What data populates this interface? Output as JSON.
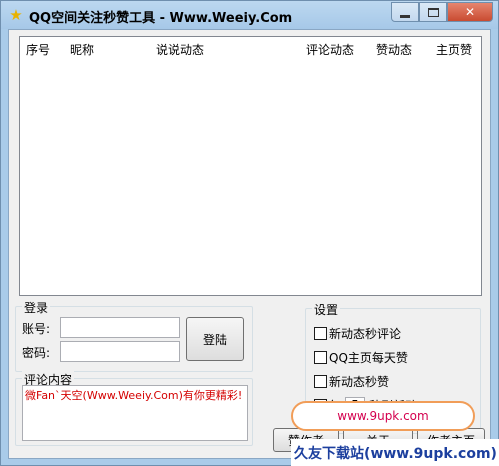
{
  "window": {
    "title": "QQ空间关注秒赞工具 - Www.Weeiy.Com",
    "app_icon": "star-icon",
    "controls": {
      "minimize": "",
      "maximize": "",
      "close": "✕"
    }
  },
  "listview": {
    "columns": [
      "序号",
      "昵称",
      "说说动态",
      "评论动态",
      "赞动态",
      "主页赞"
    ]
  },
  "login": {
    "group_title": "登录",
    "account_label": "账号:",
    "account_value": "",
    "password_label": "密码:",
    "password_value": "",
    "login_button": "登陆"
  },
  "comment": {
    "group_title": "评论内容",
    "text": "微Fan`天空(Www.Weeiy.Com)有你更精彩!"
  },
  "settings": {
    "group_title": "设置",
    "options": [
      {
        "label": "新动态秒评论",
        "checked": false
      },
      {
        "label": "QQ主页每天赞",
        "checked": false
      },
      {
        "label": "新动态秒赞",
        "checked": false
      }
    ],
    "refresh_prefix": "每",
    "refresh_value": "5",
    "refresh_suffix": "秒刷新动"
  },
  "buttons": {
    "donate": "赞作者",
    "about": "关于",
    "author_home": "作者主页"
  },
  "watermark": {
    "url": "www.9upk.com",
    "banner": "久友下载站(www.9upk.com)"
  },
  "colors": {
    "titlebar": "#a9cbe9",
    "close_button": "#c94b31",
    "comment_text": "#d40000",
    "watermark_border": "#f19d58",
    "watermark_banner": "#1c3f9e"
  }
}
